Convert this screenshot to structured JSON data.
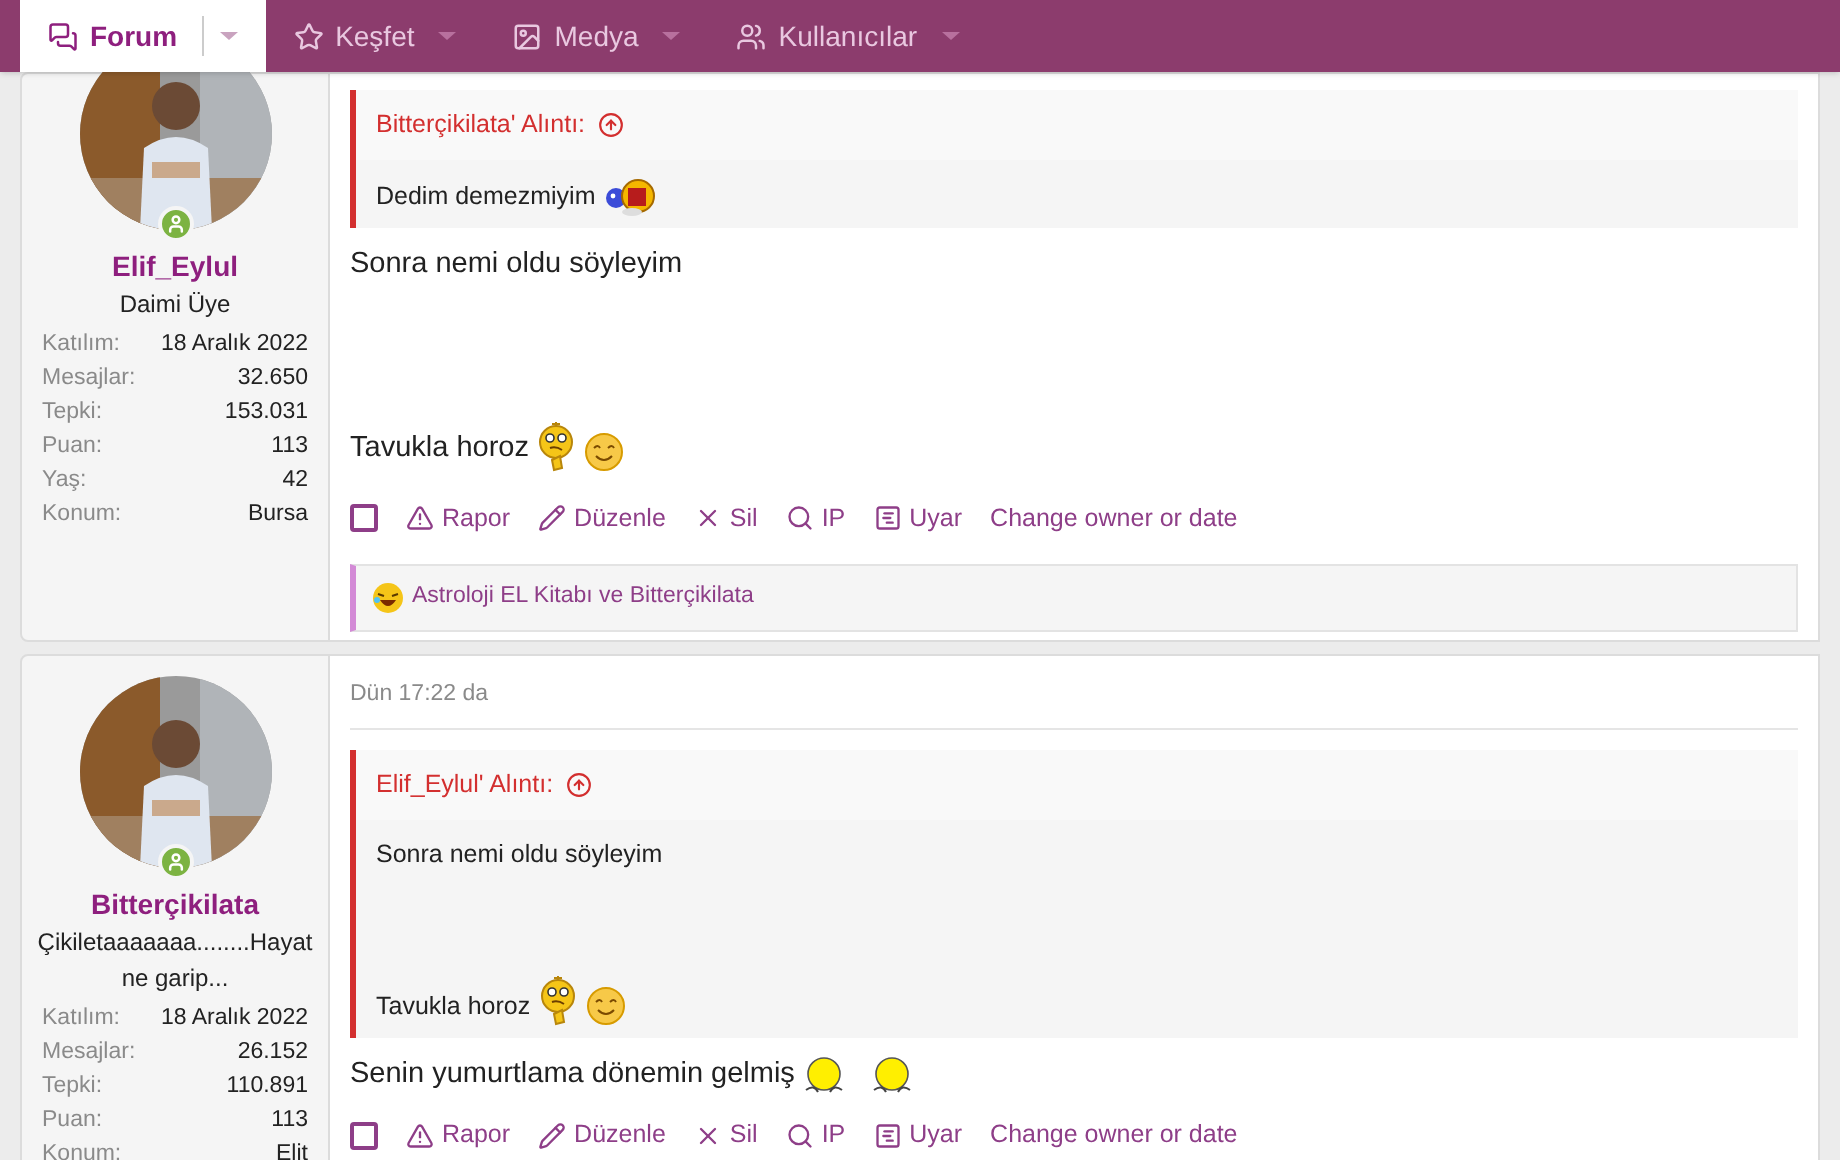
{
  "nav": {
    "items": [
      {
        "label": "Forum",
        "selected": true
      },
      {
        "label": "Keşfet",
        "selected": false
      },
      {
        "label": "Medya",
        "selected": false
      },
      {
        "label": "Kullanıcılar",
        "selected": false
      }
    ]
  },
  "posts": [
    {
      "user": {
        "name": "Elif_Eylul",
        "title": "Daimi Üye",
        "online": true,
        "stats": [
          {
            "label": "Katılım:",
            "value": "18 Aralık 2022"
          },
          {
            "label": "Mesajlar:",
            "value": "32.650"
          },
          {
            "label": "Tepki:",
            "value": "153.031"
          },
          {
            "label": "Puan:",
            "value": "113"
          },
          {
            "label": "Yaş:",
            "value": "42"
          },
          {
            "label": "Konum:",
            "value": "Bursa"
          }
        ]
      },
      "quote": {
        "header": "Bitterçikilata' Alıntı:",
        "blocks": [
          {
            "kind": "text",
            "text": "Dedim demezmiyim"
          }
        ]
      },
      "blocks": [
        {
          "kind": "text",
          "text": "Sonra nemi oldu söyleyim"
        },
        {
          "kind": "gap"
        },
        {
          "kind": "text",
          "text": "Tavukla horoz"
        }
      ],
      "actions": [
        "Rapor",
        "Düzenle",
        "Sil",
        "IP",
        "Uyar",
        "Change owner or date"
      ],
      "selected": false,
      "reactions": {
        "text": "Astroloji EL Kitabı ve Bitterçikilata"
      }
    },
    {
      "user": {
        "name": "Bitterçikilata",
        "title": "Çikiletaaaaaaa........Hayat ne garip...",
        "online": true,
        "stats": [
          {
            "label": "Katılım:",
            "value": "18 Aralık 2022"
          },
          {
            "label": "Mesajlar:",
            "value": "26.152"
          },
          {
            "label": "Tepki:",
            "value": "110.891"
          },
          {
            "label": "Puan:",
            "value": "113"
          },
          {
            "label": "Konum:",
            "value": "Elit"
          }
        ]
      },
      "date": "Dün 17:22 da",
      "quote": {
        "header": "Elif_Eylul' Alıntı:",
        "blocks": [
          {
            "kind": "text",
            "text": "Sonra nemi oldu söyleyim"
          },
          {
            "kind": "gap"
          },
          {
            "kind": "text",
            "text": "Tavukla horoz"
          }
        ]
      },
      "blocks": [
        {
          "kind": "text",
          "text": "Senin yumurtlama dönemin gelmiş"
        }
      ],
      "actions": [
        "Rapor",
        "Düzenle",
        "Sil",
        "IP",
        "Uyar",
        "Change owner or date"
      ],
      "selected": false
    }
  ]
}
